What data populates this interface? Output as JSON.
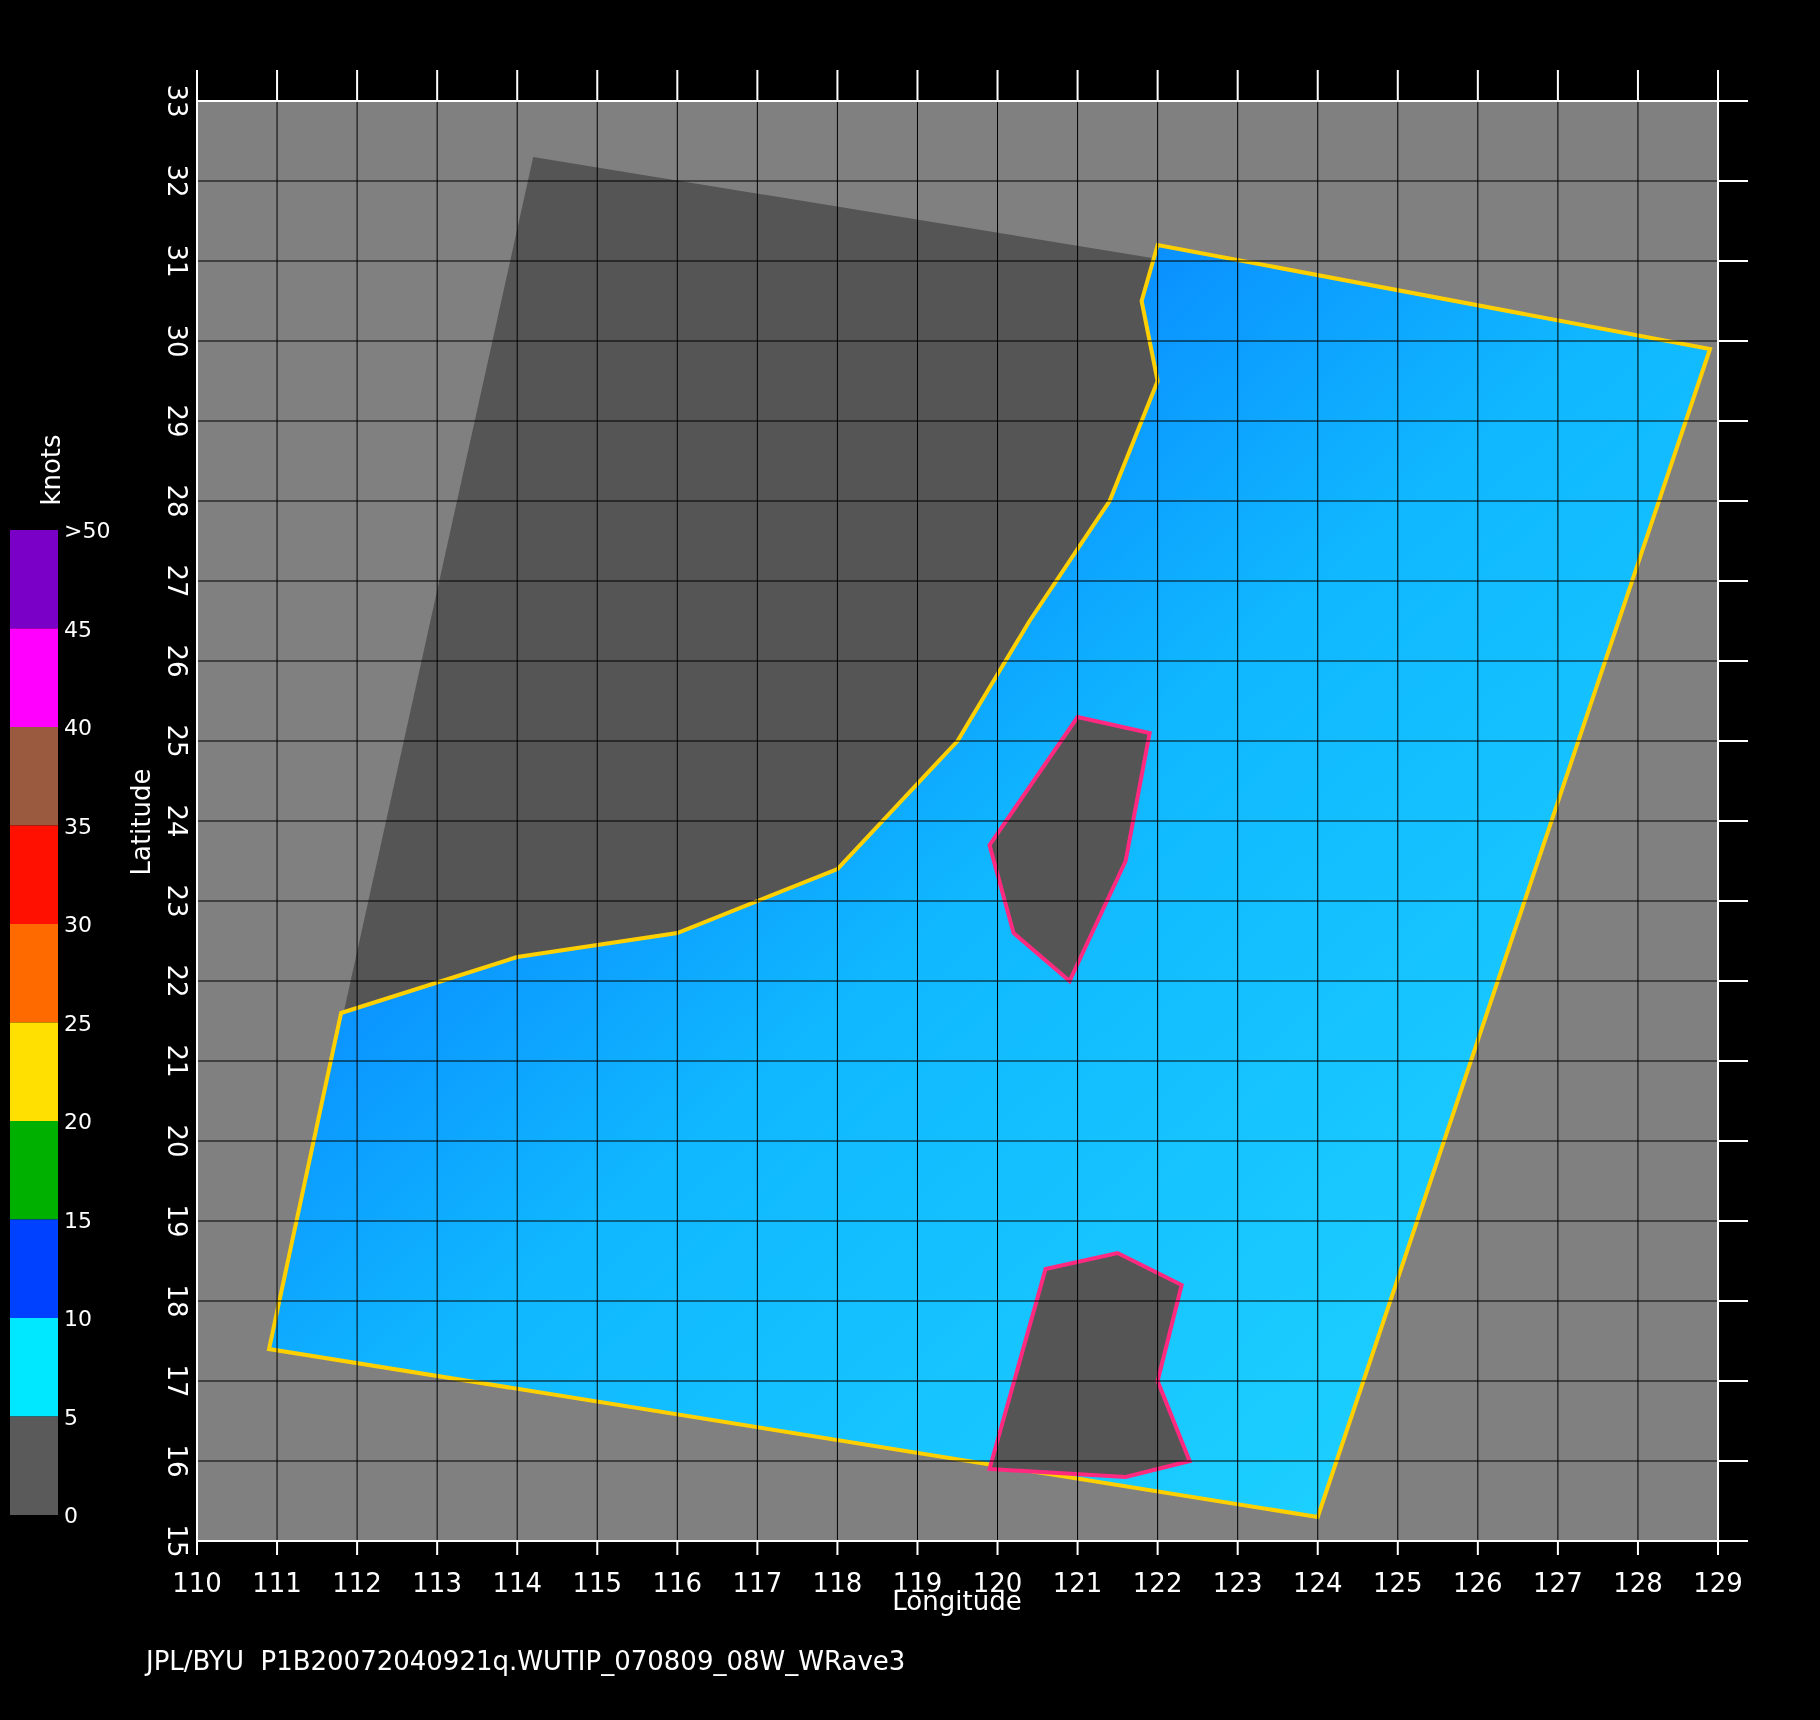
{
  "x_axis": {
    "label": "Longitude",
    "ticks": [
      "110",
      "111",
      "112",
      "113",
      "114",
      "115",
      "116",
      "117",
      "118",
      "119",
      "120",
      "121",
      "122",
      "123",
      "124",
      "125",
      "126",
      "127",
      "128",
      "129"
    ]
  },
  "y_axis": {
    "label": "Latitude",
    "ticks": [
      "15",
      "16",
      "17",
      "18",
      "19",
      "20",
      "21",
      "22",
      "23",
      "24",
      "25",
      "26",
      "27",
      "28",
      "29",
      "30",
      "31",
      "32",
      "33"
    ]
  },
  "colorbar": {
    "unit": "knots",
    "labels": [
      ">50",
      "45",
      "40",
      "35",
      "30",
      "25",
      "20",
      "15",
      "10",
      "5",
      "0"
    ],
    "bands": [
      {
        "color": "#7a00c8"
      },
      {
        "color": "#ff00ff"
      },
      {
        "color": "#9a5a40"
      },
      {
        "color": "#ff1000"
      },
      {
        "color": "#ff6a00"
      },
      {
        "color": "#ffe000"
      },
      {
        "color": "#00b000"
      },
      {
        "color": "#0040ff"
      },
      {
        "color": "#00e8ff"
      },
      {
        "color": "#5a5a5a"
      }
    ]
  },
  "footer": "JPL/BYU  P1B20072040921q.WUTIP_070809_08W_WRave3"
}
